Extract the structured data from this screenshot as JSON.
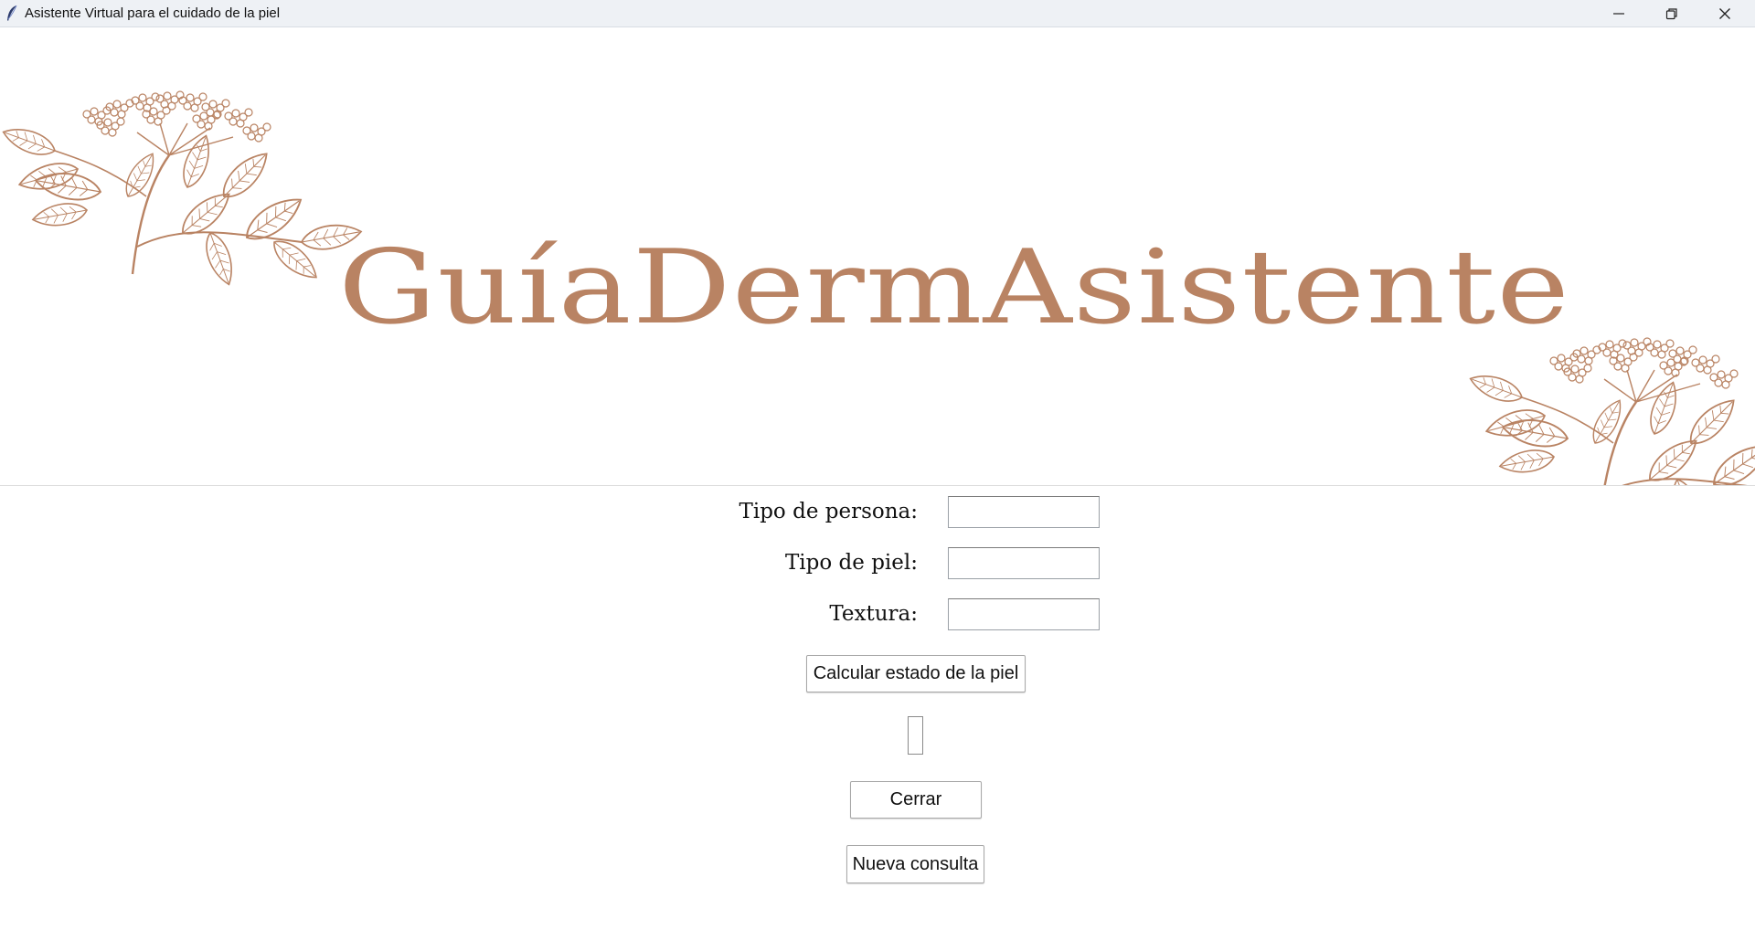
{
  "window": {
    "title": "Asistente Virtual para el cuidado de la piel",
    "controls": {
      "minimize_icon": "minimize-icon",
      "maximize_icon": "restore-icon",
      "close_icon": "close-icon"
    }
  },
  "banner": {
    "logo_text": "GuíaDermAsistente",
    "accent_color": "#b98363",
    "decorations": [
      "elderflower-branch-illustration",
      "elderflower-branch-illustration"
    ]
  },
  "form": {
    "fields": [
      {
        "label": "Tipo de persona:",
        "value": ""
      },
      {
        "label": "Tipo de piel:",
        "value": ""
      },
      {
        "label": "Textura:",
        "value": ""
      }
    ],
    "calculate_button": "Calcular estado de la piel",
    "result_text": "",
    "close_button": "Cerrar",
    "new_query_button": "Nueva consulta"
  }
}
